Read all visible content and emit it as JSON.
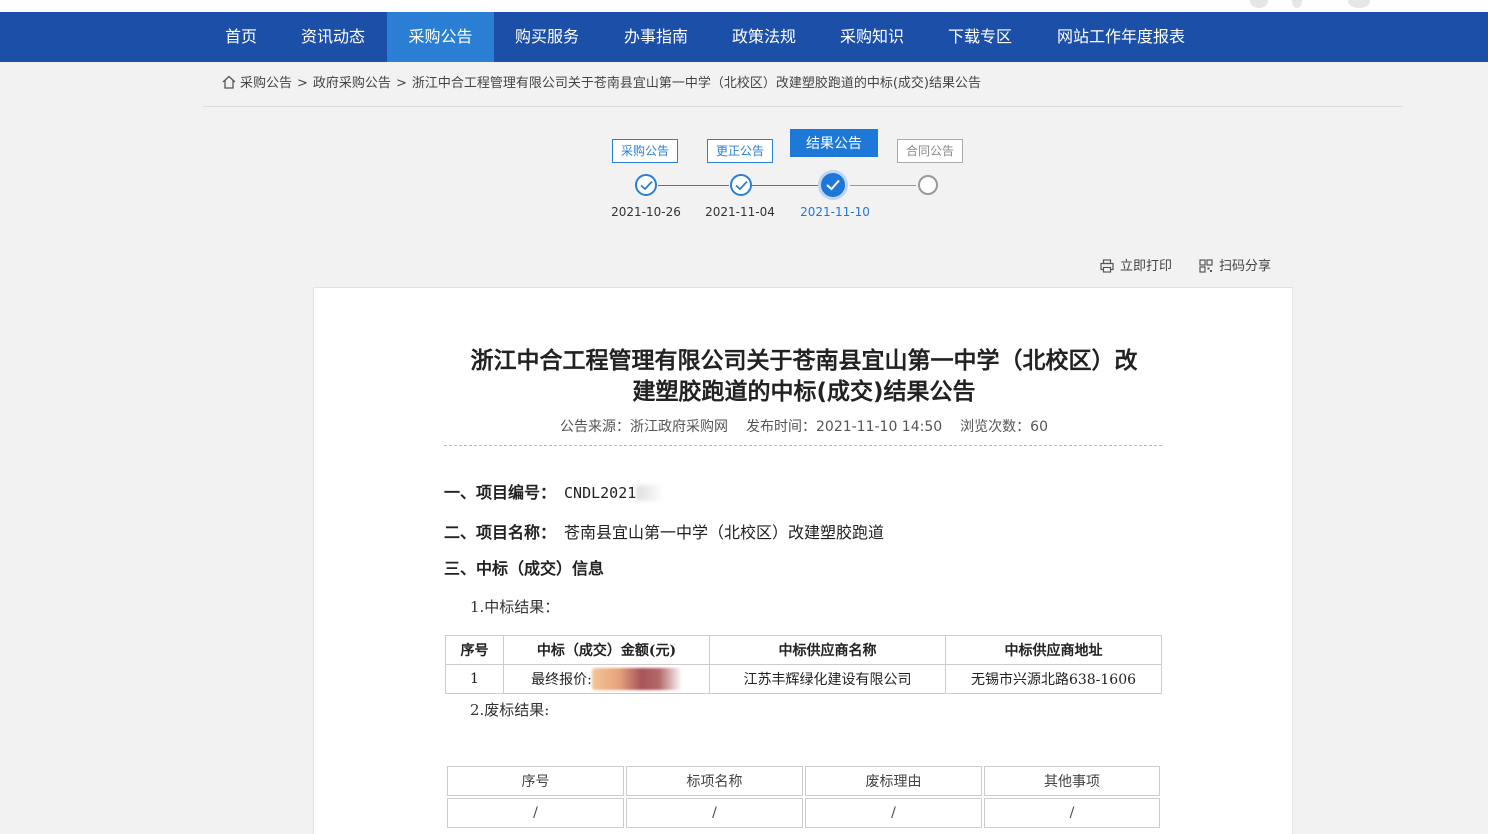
{
  "nav": {
    "items": [
      "首页",
      "资讯动态",
      "采购公告",
      "购买服务",
      "办事指南",
      "政策法规",
      "采购知识",
      "下载专区",
      "网站工作年度报表"
    ],
    "active_index": 2
  },
  "breadcrumb": {
    "items": [
      "采购公告",
      "政府采购公告",
      "浙江中合工程管理有限公司关于苍南县宜山第一中学（北校区）改建塑胶跑道的中标(成交)结果公告"
    ],
    "separator": ">"
  },
  "timeline": {
    "stages": [
      {
        "label": "采购公告",
        "date": "2021-10-26",
        "state": "done"
      },
      {
        "label": "更正公告",
        "date": "2021-11-04",
        "state": "done"
      },
      {
        "label": "结果公告",
        "date": "2021-11-10",
        "state": "current"
      },
      {
        "label": "合同公告",
        "date": "",
        "state": "future"
      }
    ]
  },
  "tools": {
    "print_label": "立即打印",
    "share_label": "扫码分享"
  },
  "document": {
    "title_line1": "浙江中合工程管理有限公司关于苍南县宜山第一中学（北校区）改",
    "title_line2": "建塑胶跑道的中标(成交)结果公告",
    "source_label": "公告来源：",
    "source": "浙江政府采购网",
    "publish_label": "发布时间：",
    "publish_time": "2021-11-10 14:50",
    "views_label": "浏览次数：",
    "views": "60",
    "section1_label": "一、项目编号：",
    "project_number": "CNDL2021",
    "section2_label": "二、项目名称：",
    "project_name": "苍南县宜山第一中学（北校区）改建塑胶跑道",
    "section3_label": "三、中标（成交）信息",
    "sub1": "1.中标结果：",
    "result_table": {
      "headers": [
        "序号",
        "中标（成交）金额(元)",
        "中标供应商名称",
        "中标供应商地址"
      ],
      "rows": [
        [
          "1",
          "最终报价:",
          "江苏丰辉绿化建设有限公司",
          "无锡市兴源北路638-1606"
        ]
      ]
    },
    "sub2": "2.废标结果:",
    "waste_table": {
      "headers": [
        "序号",
        "标项名称",
        "废标理由",
        "其他事项"
      ],
      "rows": [
        [
          "/",
          "/",
          "/",
          "/"
        ]
      ]
    }
  },
  "colors": {
    "nav_bg": "#1c4fa8",
    "nav_active": "#2a7fd4",
    "accent": "#1e78d7"
  }
}
